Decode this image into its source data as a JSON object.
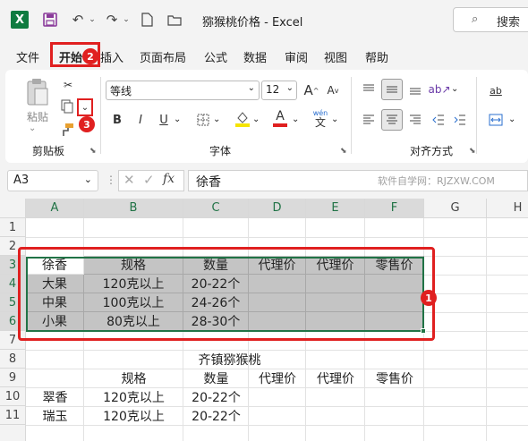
{
  "titlebar": {
    "app_title": "猕猴桃价格  -  Excel",
    "search_placeholder": "搜索"
  },
  "menu": {
    "tabs": [
      "文件",
      "开始",
      "插入",
      "页面布局",
      "公式",
      "数据",
      "审阅",
      "视图",
      "帮助"
    ]
  },
  "ribbon": {
    "paste_label": "粘贴",
    "clipboard_label": "剪贴板",
    "font_name": "等线",
    "font_size": "12",
    "font_label": "字体",
    "align_label": "对齐方式",
    "bold": "B",
    "italic": "I",
    "underline": "U",
    "wen": "wén",
    "wen_char": "文",
    "font_grow": "A",
    "font_shrink": "A",
    "font_color": "A",
    "ab": "ab"
  },
  "annotations": [
    "1",
    "2",
    "3"
  ],
  "formula_bar": {
    "name_box": "A3",
    "fx": "fx",
    "content": "徐香",
    "watermark": "软件自学网：RJZXW.COM"
  },
  "sheet": {
    "columns": [
      "A",
      "B",
      "C",
      "D",
      "E",
      "F",
      "G",
      "H"
    ],
    "rows": [
      "1",
      "2",
      "3",
      "4",
      "5",
      "6",
      "7",
      "8",
      "9",
      "10",
      "11"
    ],
    "table1": {
      "headers": [
        "徐香",
        "规格",
        "数量",
        "代理价",
        "代理价",
        "零售价"
      ],
      "rows": [
        [
          "大果",
          "120克以上",
          "20-22个"
        ],
        [
          "中果",
          "100克以上",
          "24-26个"
        ],
        [
          "小果",
          "80克以上",
          "28-30个"
        ]
      ]
    },
    "title2": "齐镇猕猴桃",
    "table2": {
      "headers": [
        "规格",
        "数量",
        "代理价",
        "代理价",
        "零售价"
      ],
      "rows": [
        [
          "翠香",
          "120克以上",
          "20-22个"
        ],
        [
          "瑞玉",
          "120克以上",
          "20-22个"
        ]
      ]
    }
  }
}
